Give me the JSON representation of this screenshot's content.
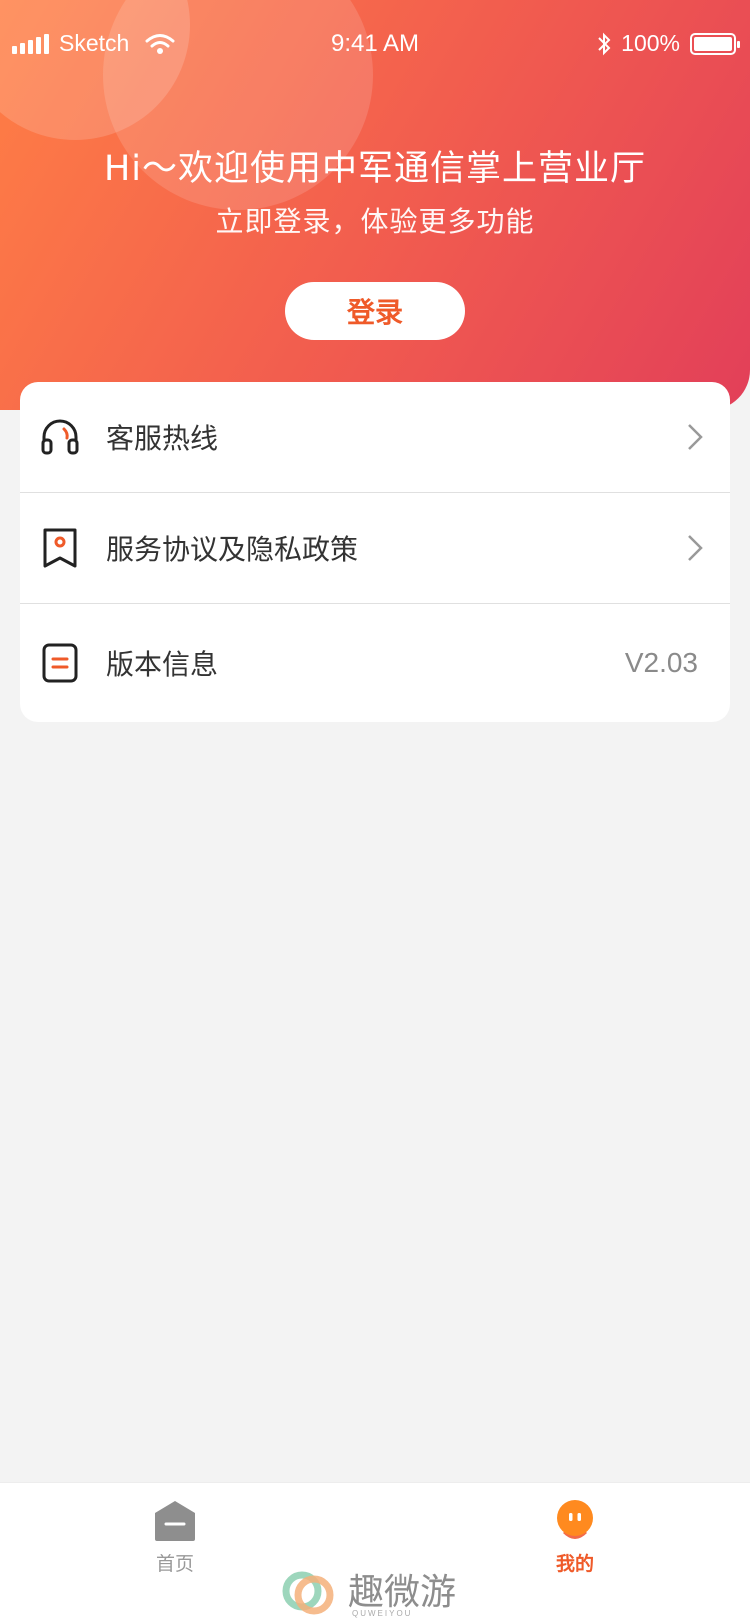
{
  "status_bar": {
    "carrier": "Sketch",
    "time": "9:41 AM",
    "battery": "100%"
  },
  "hero": {
    "greeting": "Hi～欢迎使用中军通信掌上营业厅",
    "subtitle": "立即登录，体验更多功能",
    "login_label": "登录"
  },
  "menu": {
    "items": [
      {
        "label": "客服热线",
        "icon": "headset-icon"
      },
      {
        "label": "服务协议及隐私政策",
        "icon": "bookmark-icon"
      },
      {
        "label": "版本信息",
        "icon": "document-icon",
        "value": "V2.03"
      }
    ]
  },
  "tabbar": {
    "tabs": [
      {
        "label": "首页",
        "icon": "home-icon",
        "active": false
      },
      {
        "label": "我的",
        "icon": "profile-icon",
        "active": true
      }
    ]
  },
  "watermark": {
    "text": "趣微游",
    "sub": "QUWEIYOU"
  },
  "colors": {
    "accent": "#ef5a29",
    "gradient_start": "#ff7f45",
    "gradient_end": "#e23f59",
    "background": "#f3f3f3"
  }
}
